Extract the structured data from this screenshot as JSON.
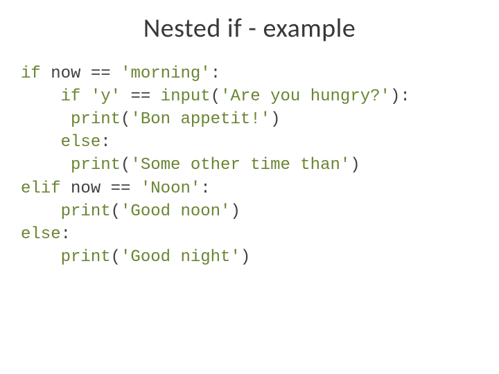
{
  "title": "Nested if - example",
  "code": {
    "l1": {
      "kw_if": "if",
      "var": "now",
      "op": "==",
      "str": "'morning'",
      "colon": ":"
    },
    "l2": {
      "kw_if": "if",
      "str_y": "'y'",
      "op": "==",
      "fn_input": "input",
      "lp": "(",
      "str_prompt": "'Are you hungry?'",
      "rp": ")",
      "colon": ":"
    },
    "l3": {
      "fn_print": "print",
      "lp": "(",
      "str": "'Bon appetit!'",
      "rp": ")"
    },
    "l4": {
      "kw_else": "else",
      "colon": ":"
    },
    "l5": {
      "fn_print": "print",
      "lp": "(",
      "str": "'Some other time than'",
      "rp": ")"
    },
    "l6": {
      "kw_elif": "elif",
      "var": "now",
      "op": "==",
      "str": "'Noon'",
      "colon": ":"
    },
    "l7": {
      "fn_print": "print",
      "lp": "(",
      "str": "'Good noon'",
      "rp": ")"
    },
    "l8": {
      "kw_else": "else",
      "colon": ":"
    },
    "l9": {
      "fn_print": "print",
      "lp": "(",
      "str": "'Good night'",
      "rp": ")"
    }
  }
}
